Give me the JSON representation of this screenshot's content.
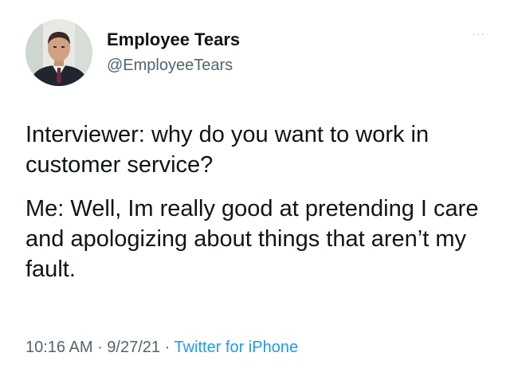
{
  "user": {
    "display_name": "Employee Tears",
    "handle": "@EmployeeTears",
    "avatar_icon": "profile-photo-man-in-suit"
  },
  "more_menu": {
    "label": "···",
    "icon": "more-options-icon"
  },
  "tweet": {
    "paragraphs": [
      "Interviewer: why do you want to work in customer service?",
      "Me: Well, Im really good at pretending I care and apologizing about things that aren’t my fault."
    ]
  },
  "meta": {
    "time": "10:16 AM",
    "separator": " · ",
    "date": "9/27/21",
    "source": "Twitter for iPhone"
  },
  "colors": {
    "text": "#0f1419",
    "secondary": "#536471",
    "link": "#1d9bf0",
    "background": "#ffffff"
  }
}
